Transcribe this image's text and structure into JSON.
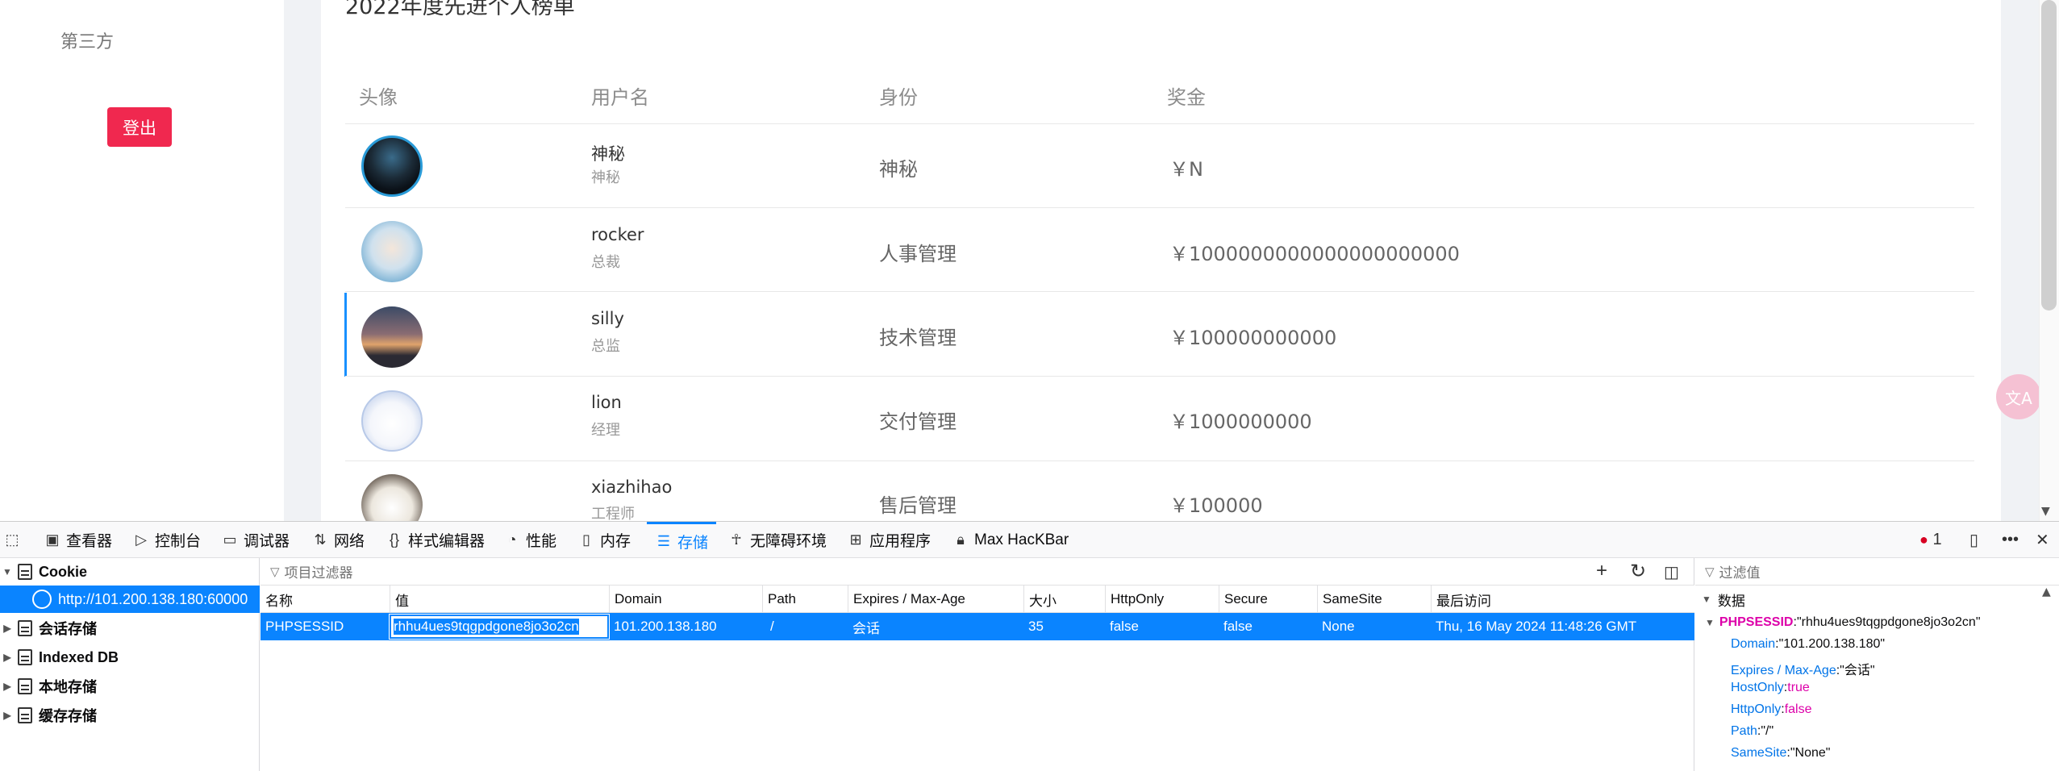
{
  "page": {
    "side_menu": {
      "third_party": "第三方",
      "logout": "登出"
    },
    "table_title": "2022年度先进个人榜单",
    "columns": [
      "头像",
      "用户名",
      "身份",
      "奖金"
    ],
    "rows": [
      {
        "name": "神秘",
        "title": "神秘",
        "role": "神秘",
        "bonus": "￥N"
      },
      {
        "name": "rocker",
        "title": "总裁",
        "role": "人事管理",
        "bonus": "￥1000000000000000000000"
      },
      {
        "name": "silly",
        "title": "总监",
        "role": "技术管理",
        "bonus": "￥100000000000"
      },
      {
        "name": "lion",
        "title": "经理",
        "role": "交付管理",
        "bonus": "￥1000000000"
      },
      {
        "name": "xiazhihao",
        "title": "工程师",
        "role": "售后管理",
        "bonus": "￥100000"
      }
    ],
    "translate_icon": "translate-icon"
  },
  "devtools": {
    "tabs": [
      {
        "label": "查看器",
        "icon": "inspector-icon"
      },
      {
        "label": "控制台",
        "icon": "console-icon"
      },
      {
        "label": "调试器",
        "icon": "debugger-icon"
      },
      {
        "label": "网络",
        "icon": "network-icon"
      },
      {
        "label": "样式编辑器",
        "icon": "style-editor-icon"
      },
      {
        "label": "性能",
        "icon": "performance-icon"
      },
      {
        "label": "内存",
        "icon": "memory-icon"
      },
      {
        "label": "存储",
        "icon": "storage-icon"
      },
      {
        "label": "无障碍环境",
        "icon": "accessibility-icon"
      },
      {
        "label": "应用程序",
        "icon": "application-icon"
      },
      {
        "label": "Max HacKBar",
        "icon": "hackbar-icon"
      }
    ],
    "active_tab": "存储",
    "error_count": "1",
    "sidebar": {
      "cookie": "Cookie",
      "host": "http://101.200.138.180:60000",
      "session_storage": "会话存储",
      "indexed_db": "Indexed DB",
      "local_storage": "本地存储",
      "cache_storage": "缓存存储"
    },
    "filter_placeholder": "项目过滤器",
    "headers": [
      "名称",
      "值",
      "Domain",
      "Path",
      "Expires / Max-Age",
      "大小",
      "HttpOnly",
      "Secure",
      "SameSite",
      "最后访问"
    ],
    "cookie": {
      "name": "PHPSESSID",
      "value": "rhhu4ues9tqgpdgone8jo3o2cn",
      "domain": "101.200.138.180",
      "path": "/",
      "expires": "会话",
      "size": "35",
      "httponly": "false",
      "secure": "false",
      "samesite": "None",
      "last_accessed": "Thu, 16 May 2024 11:48:26 GMT"
    },
    "data_panel": {
      "filter_placeholder": "过滤值",
      "heading": "数据",
      "key": "PHPSESSID",
      "key_value": "\"rhhu4ues9tqgpdgone8jo3o2cn\"",
      "fields": [
        {
          "k": "Domain",
          "v": "\"101.200.138.180\""
        },
        {
          "k": "Expires / Max-Age",
          "v": "\"会话\""
        },
        {
          "k": "HostOnly",
          "v": "true"
        },
        {
          "k": "HttpOnly",
          "v": "false"
        },
        {
          "k": "Path",
          "v": "\"/\""
        },
        {
          "k": "SameSite",
          "v": "\"None\""
        }
      ]
    },
    "colors": {
      "accent": "#0a84ff",
      "logout": "#f0284f",
      "bool": "#dd00a9"
    }
  }
}
